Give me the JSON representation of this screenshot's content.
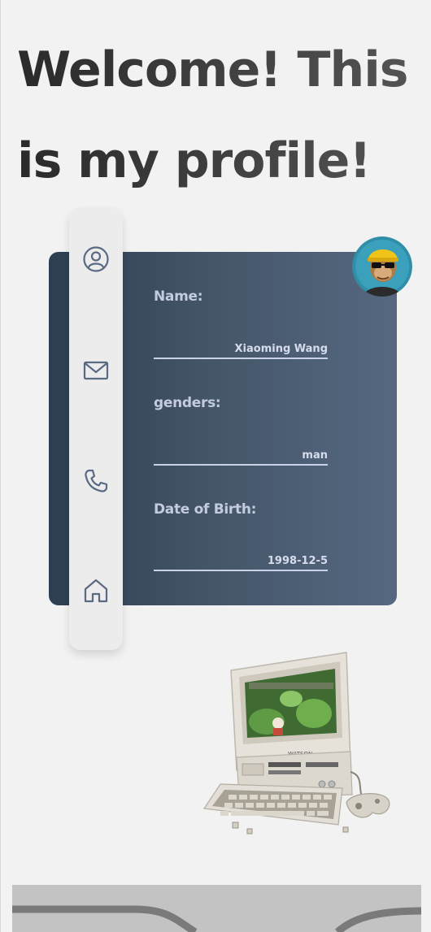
{
  "header": {
    "title": "Welcome! This is my profile!"
  },
  "nav": {
    "items": [
      {
        "icon": "user-circle-icon"
      },
      {
        "icon": "mail-icon"
      },
      {
        "icon": "phone-icon"
      },
      {
        "icon": "home-icon"
      }
    ]
  },
  "profile": {
    "name_label": "Name:",
    "name_value": "Xiaoming Wang",
    "gender_label": "genders:",
    "gender_value": "man",
    "dob_label": "Date of Birth:",
    "dob_value": "1998-12-5"
  },
  "colors": {
    "card_start": "#2d3e52",
    "card_end": "#566880",
    "label": "#c3cbe0",
    "background": "#f2f2f2"
  }
}
